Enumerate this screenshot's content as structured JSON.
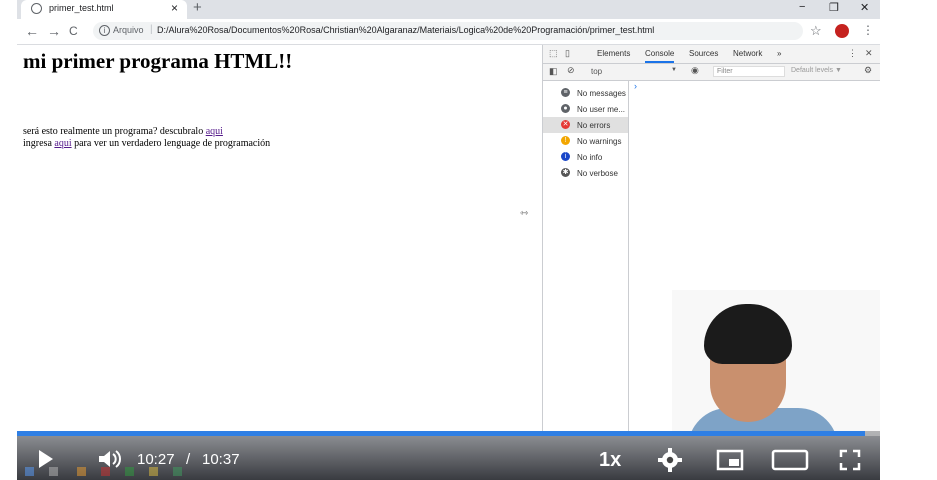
{
  "browser": {
    "tab_title": "primer_test.html",
    "tab_close": "×",
    "new_tab": "+",
    "window_controls": [
      "−",
      "❐",
      "✕"
    ],
    "nav": {
      "back": "←",
      "forward": "→",
      "reload": "C"
    },
    "info": "i",
    "arquivo": "Arquivo",
    "separator": "|",
    "url": "D:/Alura%20Rosa/Documentos%20Rosa/Christian%20Algaranaz/Materiais/Logica%20de%20Programación/primer_test.html",
    "star": "☆",
    "menu": "⋮"
  },
  "page": {
    "heading": "mi primer programa HTML!!",
    "line1_text": "será esto realmente un programa? descubralo ",
    "line1_link": "aqui",
    "line2_pre": "ingresa ",
    "line2_link": "aqui",
    "line2_post": " para ver un verdadero lenguage de programación"
  },
  "devtools": {
    "tabs": [
      "Elements",
      "Console",
      "Sources",
      "Network",
      "»"
    ],
    "active_tab": "Console",
    "context": "top",
    "context_caret": "▼",
    "filter_placeholder": "Filter",
    "levels": "Default levels ▼",
    "more": "⋮",
    "close": "✕",
    "prompt": "›",
    "sidebar": [
      {
        "label": "No messages",
        "icon": "list-icon",
        "color": "#5f6368"
      },
      {
        "label": "No user me...",
        "icon": "user-icon",
        "color": "#5f6368"
      },
      {
        "label": "No errors",
        "icon": "error-icon",
        "color": "#e53935"
      },
      {
        "label": "No warnings",
        "icon": "warning-icon",
        "color": "#f2a600"
      },
      {
        "label": "No info",
        "icon": "info-icon",
        "color": "#1a47c8"
      },
      {
        "label": "No verbose",
        "icon": "bug-icon",
        "color": "#555555"
      }
    ],
    "selected_index": 2
  },
  "video": {
    "current_time": "10:27",
    "separator": "/",
    "duration": "10:37",
    "progress_fraction": 0.983,
    "speed": "1x",
    "accent": "#2f7fe4"
  }
}
